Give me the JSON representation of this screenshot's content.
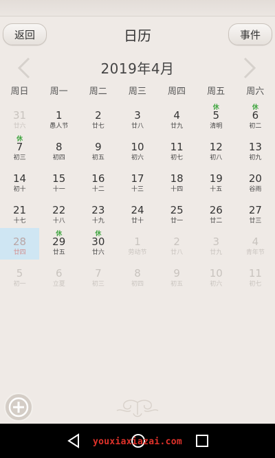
{
  "header": {
    "title": "日历",
    "back_label": "返回",
    "events_label": "事件"
  },
  "month": {
    "label": "2019年4月"
  },
  "weekdays": [
    "周日",
    "周一",
    "周二",
    "周三",
    "周四",
    "周五",
    "周六"
  ],
  "days": [
    {
      "day": "31",
      "lunar": "廿六",
      "other": true
    },
    {
      "day": "1",
      "lunar": "愚人节"
    },
    {
      "day": "2",
      "lunar": "廿七"
    },
    {
      "day": "3",
      "lunar": "廿八"
    },
    {
      "day": "4",
      "lunar": "廿九"
    },
    {
      "day": "5",
      "lunar": "清明",
      "rest": "休"
    },
    {
      "day": "6",
      "lunar": "初二",
      "rest": "休"
    },
    {
      "day": "7",
      "lunar": "初三",
      "rest": "休"
    },
    {
      "day": "8",
      "lunar": "初四"
    },
    {
      "day": "9",
      "lunar": "初五"
    },
    {
      "day": "10",
      "lunar": "初六"
    },
    {
      "day": "11",
      "lunar": "初七"
    },
    {
      "day": "12",
      "lunar": "初八"
    },
    {
      "day": "13",
      "lunar": "初九"
    },
    {
      "day": "14",
      "lunar": "初十"
    },
    {
      "day": "15",
      "lunar": "十一"
    },
    {
      "day": "16",
      "lunar": "十二"
    },
    {
      "day": "17",
      "lunar": "十三"
    },
    {
      "day": "18",
      "lunar": "十四"
    },
    {
      "day": "19",
      "lunar": "十五"
    },
    {
      "day": "20",
      "lunar": "谷雨"
    },
    {
      "day": "21",
      "lunar": "十七"
    },
    {
      "day": "22",
      "lunar": "十八"
    },
    {
      "day": "23",
      "lunar": "十九"
    },
    {
      "day": "24",
      "lunar": "廿十"
    },
    {
      "day": "25",
      "lunar": "廿一"
    },
    {
      "day": "26",
      "lunar": "廿二"
    },
    {
      "day": "27",
      "lunar": "廿三"
    },
    {
      "day": "28",
      "lunar": "廿四",
      "today": true
    },
    {
      "day": "29",
      "lunar": "廿五",
      "rest": "休"
    },
    {
      "day": "30",
      "lunar": "廿六",
      "rest": "休"
    },
    {
      "day": "1",
      "lunar": "劳动节",
      "other": true
    },
    {
      "day": "2",
      "lunar": "廿八",
      "other": true
    },
    {
      "day": "3",
      "lunar": "廿九",
      "other": true
    },
    {
      "day": "4",
      "lunar": "青年节",
      "other": true
    },
    {
      "day": "5",
      "lunar": "初一",
      "other": true
    },
    {
      "day": "6",
      "lunar": "立夏",
      "other": true
    },
    {
      "day": "7",
      "lunar": "初三",
      "other": true
    },
    {
      "day": "8",
      "lunar": "初四",
      "other": true
    },
    {
      "day": "9",
      "lunar": "初五",
      "other": true
    },
    {
      "day": "10",
      "lunar": "初六",
      "other": true
    },
    {
      "day": "11",
      "lunar": "初七",
      "other": true
    }
  ],
  "colors": {
    "background": "#efeae6",
    "rest_badge": "#3fa53f",
    "today_highlight": "#cfe6f3"
  },
  "icons": {
    "prev": "chevron-left-icon",
    "next": "chevron-right-icon",
    "add": "plus-circle-icon",
    "nav_back": "triangle-back-icon",
    "nav_home": "circle-home-icon",
    "nav_recent": "square-recent-icon"
  },
  "watermark": "youxiaxiazai.com"
}
